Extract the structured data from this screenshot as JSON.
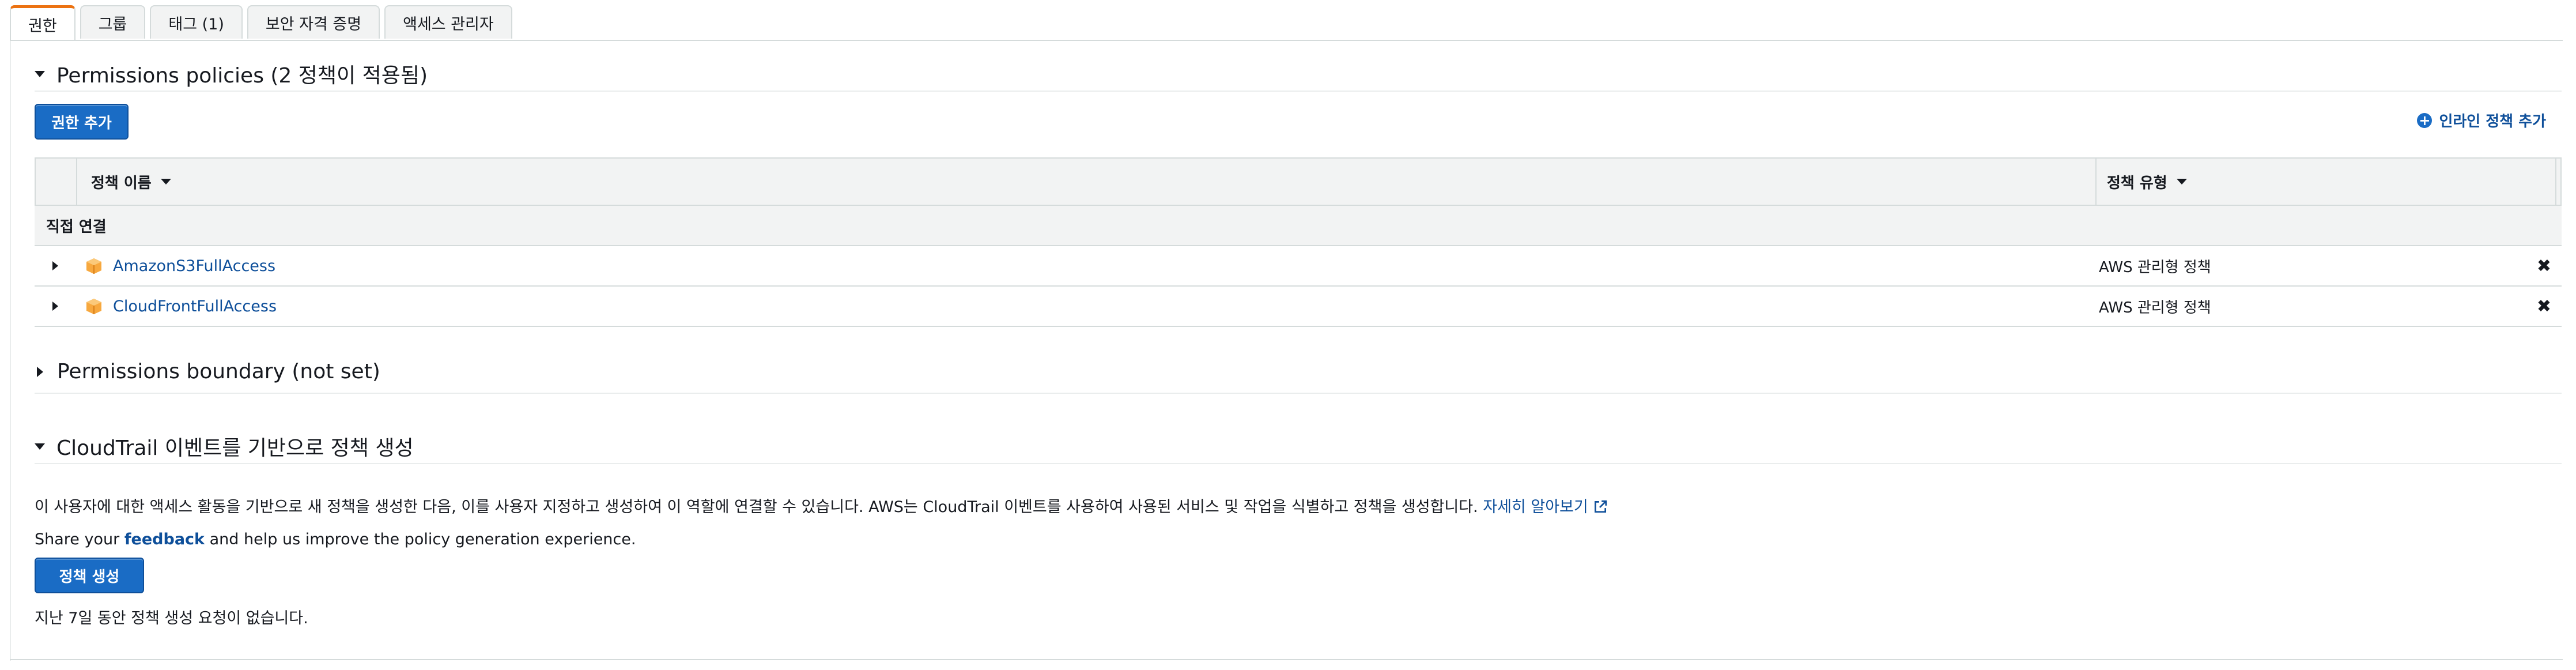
{
  "tabs": [
    {
      "label": "권한",
      "active": true
    },
    {
      "label": "그룹",
      "active": false
    },
    {
      "label": "태그 (1)",
      "active": false
    },
    {
      "label": "보안 자격 증명",
      "active": false
    },
    {
      "label": "액세스 관리자",
      "active": false
    }
  ],
  "permissions_policies": {
    "title": "Permissions policies (2 정책이 적용됨)",
    "add_button": "권한 추가",
    "inline_add": "인라인 정책 추가",
    "columns": {
      "name": "정책 이름",
      "type": "정책 유형"
    },
    "group_label": "직접 연결",
    "rows": [
      {
        "name": "AmazonS3FullAccess",
        "type": "AWS 관리형 정책",
        "icon": "aws-managed-policy-icon"
      },
      {
        "name": "CloudFrontFullAccess",
        "type": "AWS 관리형 정책",
        "icon": "aws-managed-policy-icon"
      }
    ]
  },
  "permissions_boundary": {
    "title": "Permissions boundary (not set)"
  },
  "cloudtrail": {
    "title": "CloudTrail 이벤트를 기반으로 정책 생성",
    "description": "이 사용자에 대한 액세스 활동을 기반으로 새 정책을 생성한 다음, 이를 사용자 지정하고 생성하여 이 역할에 연결할 수 있습니다. AWS는 CloudTrail 이벤트를 사용하여 사용된 서비스 및 작업을 식별하고 정책을 생성합니다.",
    "learn_more": "자세히 알아보기",
    "feedback_prefix": "Share your",
    "feedback_link": "feedback",
    "feedback_suffix": "and help us improve the policy generation experience.",
    "generate_button": "정책 생성",
    "no_requests": "지난 7일 동안 정책 생성 요청이 없습니다."
  },
  "colors": {
    "accent": "#ec7211",
    "primary": "#1a6cc5",
    "link": "#0e4f9a",
    "policy_icon": "#f29d38"
  }
}
